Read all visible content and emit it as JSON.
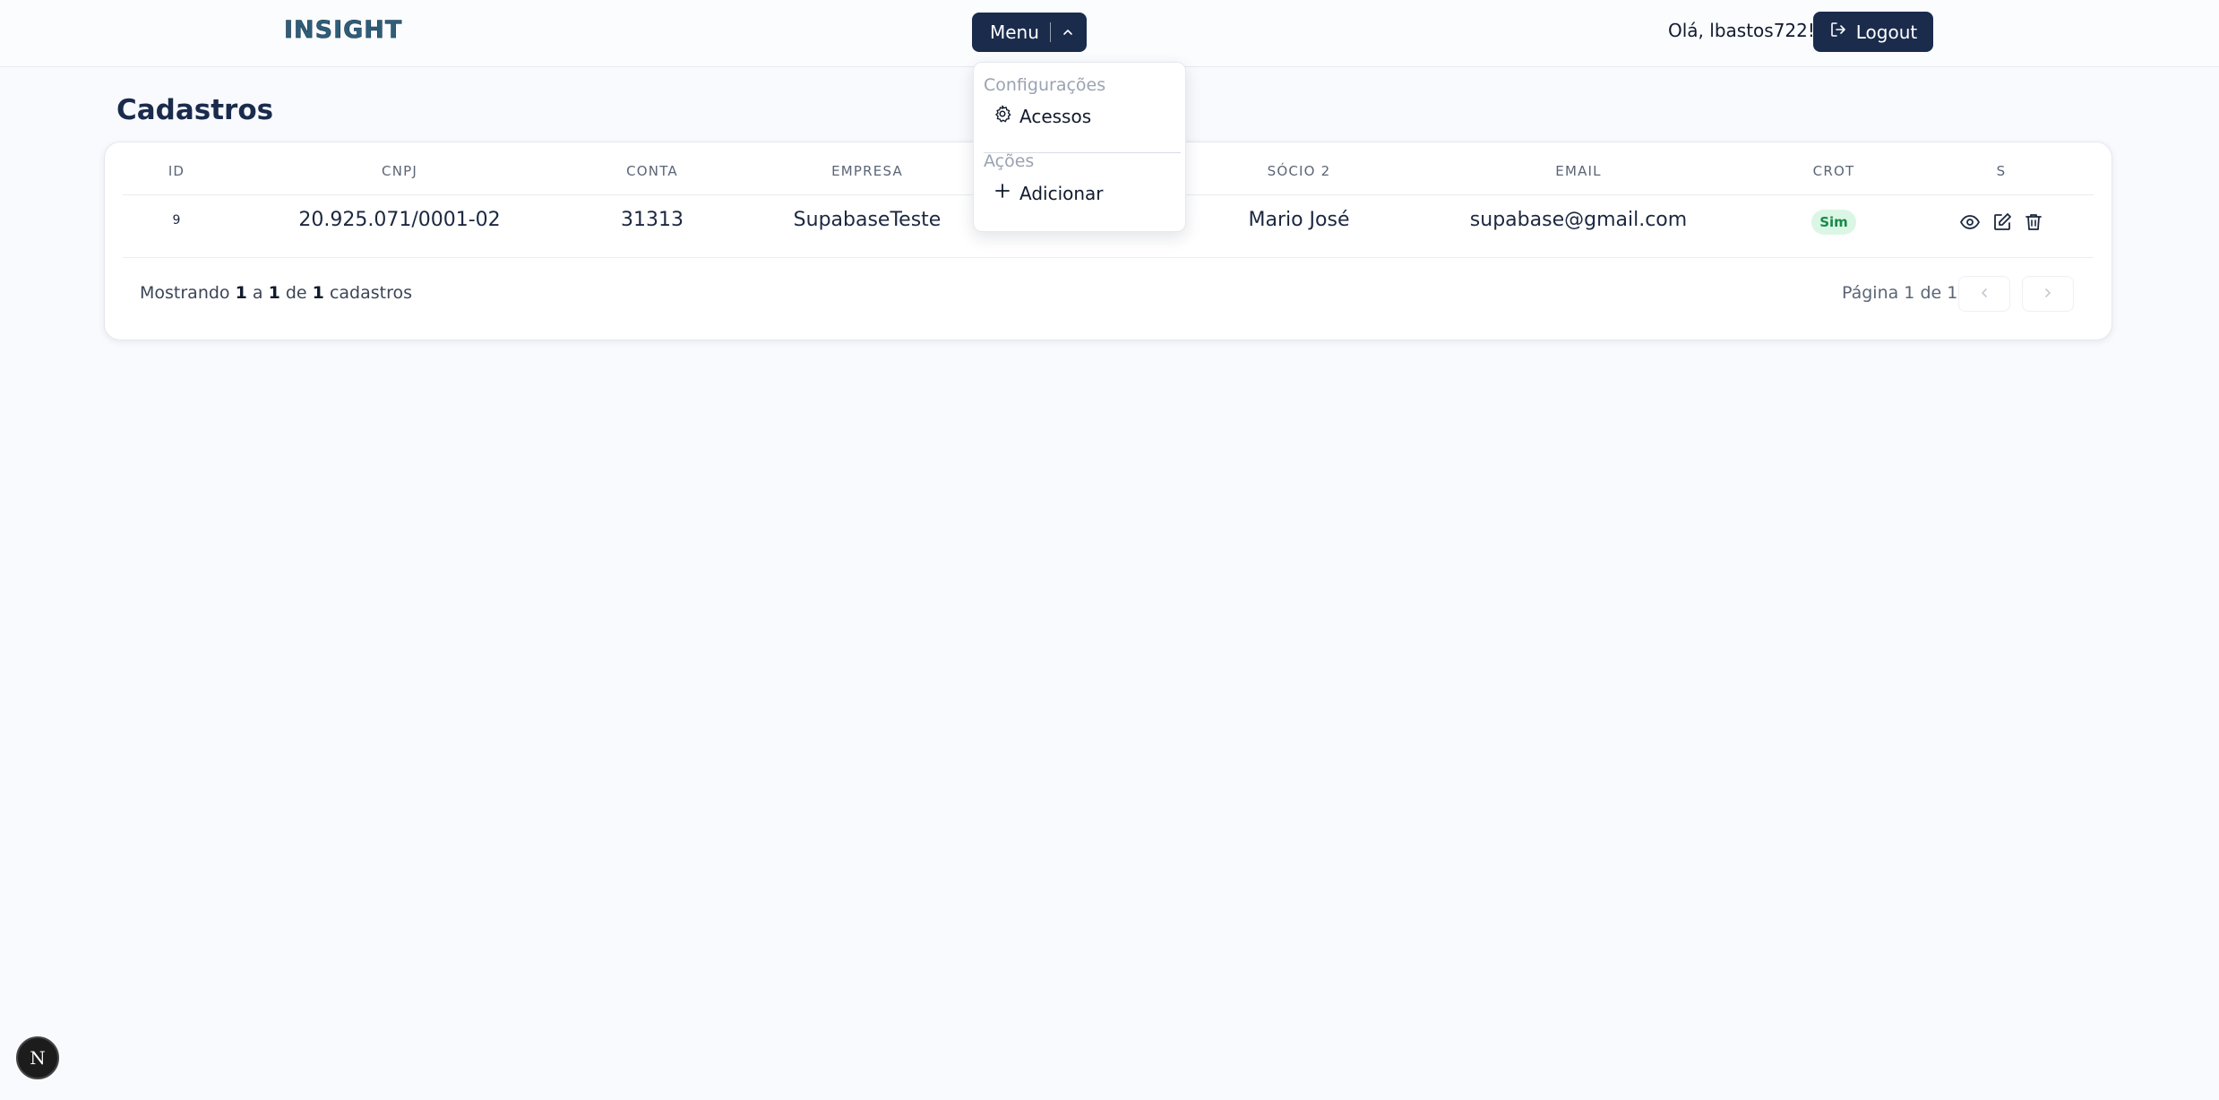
{
  "header": {
    "logo": "INSIGHT",
    "menu_label": "Menu",
    "greeting": "Olá, lbastos722!",
    "logout_label": "Logout"
  },
  "dropdown": {
    "section_config": "Configurações",
    "item_access": "Acessos",
    "section_actions": "Ações",
    "item_add": "Adicionar"
  },
  "page": {
    "title": "Cadastros"
  },
  "table": {
    "headers": [
      "ID",
      "CNPJ",
      "CONTA",
      "EMPRESA",
      "SÓCIO 2",
      "EMAIL",
      "CROT",
      "S"
    ],
    "rows": [
      {
        "id": "9",
        "cnpj": "20.925.071/0001-02",
        "conta": "31313",
        "empresa": "SupabaseTeste",
        "socio2": "Mario José",
        "email": "supabase@gmail.com",
        "crot": "Sim"
      }
    ]
  },
  "footer": {
    "showing_prefix": "Mostrando",
    "from": "1",
    "sep_a": "a",
    "to": "1",
    "sep_de": "de",
    "total": "1",
    "suffix": "cadastros",
    "page_info": "Página 1 de 1"
  },
  "colors": {
    "primary": "#1a2b4c",
    "badge_bg": "#dcf6e6",
    "badge_text": "#188a47",
    "page_bg": "#f8fafd"
  },
  "icons": [
    "chevron-up-icon",
    "logout-icon",
    "gear-icon",
    "plus-icon",
    "eye-icon",
    "edit-icon",
    "trash-icon",
    "chevron-left-icon",
    "chevron-right-icon",
    "nextjs-icon"
  ],
  "dev_badge": "N"
}
